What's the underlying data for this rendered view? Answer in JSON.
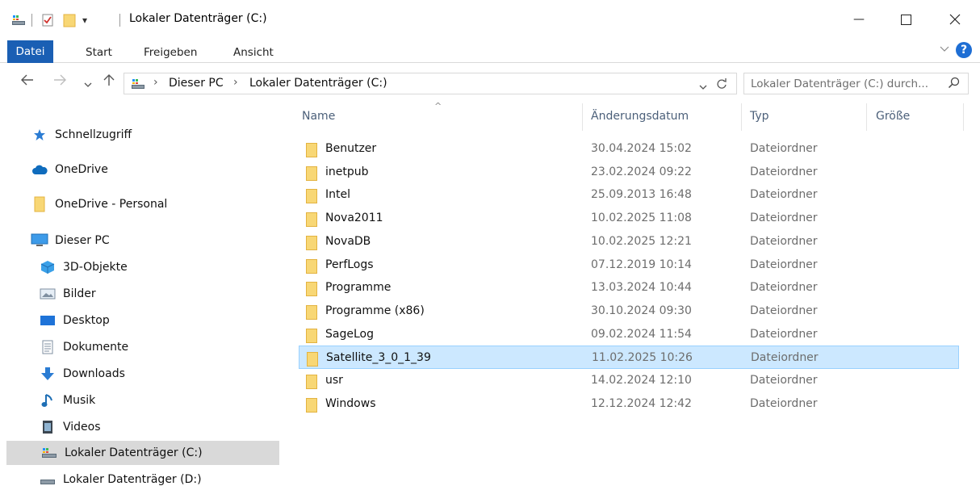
{
  "window": {
    "title": "Lokaler Datenträger (C:)",
    "minimize_glyph": "—",
    "maximize_glyph": "☐",
    "close_glyph": "✕"
  },
  "ribbon": {
    "tabs": [
      "Datei",
      "Start",
      "Freigeben",
      "Ansicht"
    ],
    "help_label": "?",
    "accent": "#1a5fb4"
  },
  "address": {
    "crumbs": [
      "Dieser PC",
      "Lokaler Datenträger (C:)"
    ],
    "separator": "›"
  },
  "search": {
    "placeholder": "Lokaler Datenträger (C:) durch..."
  },
  "navpane": {
    "items": [
      {
        "label": "Schnellzugriff",
        "icon": "star-icon"
      },
      {
        "label": "OneDrive",
        "icon": "cloud-icon"
      },
      {
        "label": "OneDrive - Personal",
        "icon": "folder-icon"
      },
      {
        "label": "Dieser PC",
        "icon": "monitor-icon"
      },
      {
        "label": "3D-Objekte",
        "icon": "cube-icon"
      },
      {
        "label": "Bilder",
        "icon": "pictures-icon"
      },
      {
        "label": "Desktop",
        "icon": "desktop-icon"
      },
      {
        "label": "Dokumente",
        "icon": "document-icon"
      },
      {
        "label": "Downloads",
        "icon": "download-icon"
      },
      {
        "label": "Musik",
        "icon": "music-icon"
      },
      {
        "label": "Videos",
        "icon": "video-icon"
      },
      {
        "label": "Lokaler Datenträger (C:)",
        "icon": "drive-icon"
      },
      {
        "label": "Lokaler Datenträger (D:)",
        "icon": "drive-icon"
      }
    ]
  },
  "filelist": {
    "columns": [
      "Name",
      "Änderungsdatum",
      "Typ",
      "Größe"
    ],
    "sort_glyph": "^",
    "rows": [
      {
        "name": "Benutzer",
        "date": "30.04.2024 15:02",
        "type": "Dateiordner"
      },
      {
        "name": "inetpub",
        "date": "23.02.2024 09:22",
        "type": "Dateiordner"
      },
      {
        "name": "Intel",
        "date": "25.09.2013 16:48",
        "type": "Dateiordner"
      },
      {
        "name": "Nova2011",
        "date": "10.02.2025 11:08",
        "type": "Dateiordner"
      },
      {
        "name": "NovaDB",
        "date": "10.02.2025 12:21",
        "type": "Dateiordner"
      },
      {
        "name": "PerfLogs",
        "date": "07.12.2019 10:14",
        "type": "Dateiordner"
      },
      {
        "name": "Programme",
        "date": "13.03.2024 10:44",
        "type": "Dateiordner"
      },
      {
        "name": "Programme (x86)",
        "date": "30.10.2024 09:30",
        "type": "Dateiordner"
      },
      {
        "name": "SageLog",
        "date": "09.02.2024 11:54",
        "type": "Dateiordner"
      },
      {
        "name": "Satellite_3_0_1_39",
        "date": "11.02.2025 10:26",
        "type": "Dateiordner"
      },
      {
        "name": "usr",
        "date": "14.02.2024 12:10",
        "type": "Dateiordner"
      },
      {
        "name": "Windows",
        "date": "12.12.2024 12:42",
        "type": "Dateiordner"
      }
    ],
    "selected_row": "Satellite_3_0_1_39",
    "selection_color": "#cce8ff",
    "folder_color": "#f8d775"
  }
}
